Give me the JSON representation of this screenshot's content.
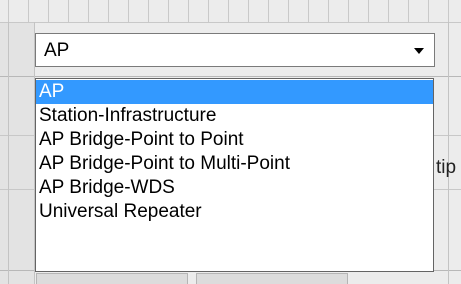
{
  "combo": {
    "value": "AP",
    "arrow_icon": "chevron-down-icon"
  },
  "dropdown": {
    "selected_index": 0,
    "options": [
      "AP",
      "Station-Infrastructure",
      "AP Bridge-Point to Point",
      "AP Bridge-Point to Multi-Point",
      "AP Bridge-WDS",
      "Universal Repeater"
    ]
  },
  "background": {
    "partial_label": "tip"
  },
  "colors": {
    "selection": "#3399ff",
    "selection_text": "#ffffff"
  }
}
